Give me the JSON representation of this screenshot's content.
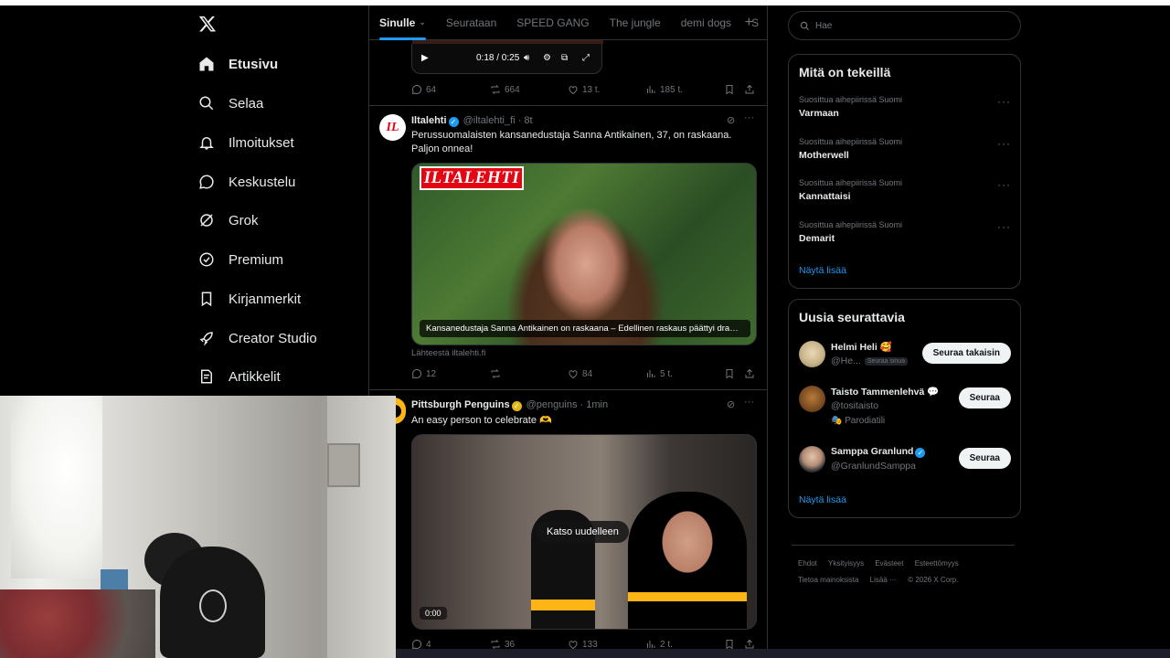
{
  "nav": {
    "items": [
      {
        "label": "Etusivu",
        "icon": "home-icon",
        "active": true
      },
      {
        "label": "Selaa",
        "icon": "search-icon"
      },
      {
        "label": "Ilmoitukset",
        "icon": "bell-icon"
      },
      {
        "label": "Keskustelu",
        "icon": "chat-icon"
      },
      {
        "label": "Grok",
        "icon": "grok-icon"
      },
      {
        "label": "Premium",
        "icon": "verified-badge-icon"
      },
      {
        "label": "Kirjanmerkit",
        "icon": "bookmark-icon"
      },
      {
        "label": "Creator Studio",
        "icon": "rocket-icon"
      },
      {
        "label": "Artikkelit",
        "icon": "article-icon"
      }
    ]
  },
  "tabs": [
    {
      "label": "Sinulle",
      "active": true
    },
    {
      "label": "Seurataan"
    },
    {
      "label": "SPEED GANG"
    },
    {
      "label": "The jungle"
    },
    {
      "label": "demi dogs"
    },
    {
      "label": "S"
    }
  ],
  "video": {
    "time": "0:18 / 0:25"
  },
  "tweet0": {
    "replies": "64",
    "reposts": "664",
    "likes": "13 t.",
    "views": "185 t."
  },
  "tweet1": {
    "avatar_text": "IL",
    "name": "Iltalehti",
    "handle": "@iltalehti_fi",
    "time": "· 8t",
    "text": "Perussuomalaisten kansanedustaja Sanna Antikainen, 37, on raskaana. Paljon onnea!",
    "media_logo": "ILTALEHTI",
    "media_caption": "Kansanedustaja Sanna Antikainen on raskaana – Edellinen raskaus päättyi dram…",
    "source": "Lähteestä iltalehti.fi",
    "replies": "12",
    "reposts": "",
    "likes": "84",
    "views": "5 t."
  },
  "tweet2": {
    "name": "Pittsburgh Penguins",
    "handle": "@penguins",
    "time": "· 1min",
    "text": "An easy person to celebrate 🫶",
    "replay": "Katso uudelleen",
    "video_time": "0:00",
    "replies": "4",
    "reposts": "36",
    "likes": "133",
    "views": "2 t."
  },
  "search": {
    "placeholder": "Hae"
  },
  "trends": {
    "title": "Mitä on tekeillä",
    "items": [
      {
        "context": "Suosittua aihepiirissä Suomi",
        "name": "Varmaan"
      },
      {
        "context": "Suosittua aihepiirissä Suomi",
        "name": "Motherwell"
      },
      {
        "context": "Suosittua aihepiirissä Suomi",
        "name": "Kannattaisi"
      },
      {
        "context": "Suosittua aihepiirissä Suomi",
        "name": "Demarit"
      }
    ],
    "show_more": "Näytä lisää"
  },
  "who_to_follow": {
    "title": "Uusia seurattavia",
    "items": [
      {
        "name": "Helmi Heli 🥰",
        "handle": "@He...",
        "follows_you": "Seuraa sinua",
        "button": "Seuraa takaisin"
      },
      {
        "name": "Taisto Tammenlehvä 💬",
        "handle": "@tositaisto",
        "extra": "🎭 Parodiatili",
        "button": "Seuraa"
      },
      {
        "name": "Samppa Granlund",
        "handle": "@GranlundSamppa",
        "button": "Seuraa"
      }
    ],
    "show_more": "Näytä lisää"
  },
  "footer": {
    "links": [
      "Ehdot",
      "Yksityisyys",
      "Evästeet",
      "Esteettömyys",
      "Tietoa mainoksista",
      "Lisää ···"
    ],
    "copyright": "© 2026 X Corp."
  },
  "colors": {
    "accent": "#1d9bf0",
    "background": "#000000",
    "border": "#2f3336",
    "muted": "#71767b"
  }
}
